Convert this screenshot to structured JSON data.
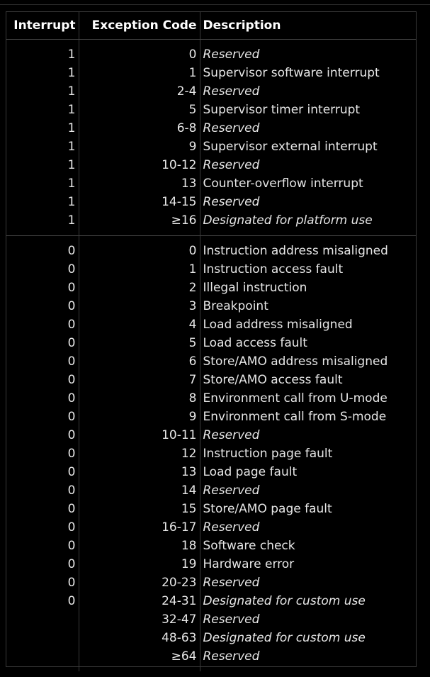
{
  "table": {
    "headers": {
      "interrupt": "Interrupt",
      "exception_code": "Exception Code",
      "description": "Description"
    },
    "interrupt_rows": [
      {
        "interrupt": "1",
        "code": "0",
        "description": "Reserved",
        "italic": true
      },
      {
        "interrupt": "1",
        "code": "1",
        "description": "Supervisor software interrupt",
        "italic": false
      },
      {
        "interrupt": "1",
        "code": "2-4",
        "description": "Reserved",
        "italic": true
      },
      {
        "interrupt": "1",
        "code": "5",
        "description": "Supervisor timer interrupt",
        "italic": false
      },
      {
        "interrupt": "1",
        "code": "6-8",
        "description": "Reserved",
        "italic": true
      },
      {
        "interrupt": "1",
        "code": "9",
        "description": "Supervisor external interrupt",
        "italic": false
      },
      {
        "interrupt": "1",
        "code": "10-12",
        "description": "Reserved",
        "italic": true
      },
      {
        "interrupt": "1",
        "code": "13",
        "description": "Counter-overflow interrupt",
        "italic": false
      },
      {
        "interrupt": "1",
        "code": "14-15",
        "description": "Reserved",
        "italic": true
      },
      {
        "interrupt": "1",
        "code": "≥16",
        "description": "Designated for platform use",
        "italic": true
      }
    ],
    "exception_rows": [
      {
        "interrupt": "0",
        "code": "0",
        "description": "Instruction address misaligned",
        "italic": false
      },
      {
        "interrupt": "0",
        "code": "1",
        "description": "Instruction access fault",
        "italic": false
      },
      {
        "interrupt": "0",
        "code": "2",
        "description": "Illegal instruction",
        "italic": false
      },
      {
        "interrupt": "0",
        "code": "3",
        "description": "Breakpoint",
        "italic": false
      },
      {
        "interrupt": "0",
        "code": "4",
        "description": "Load address misaligned",
        "italic": false
      },
      {
        "interrupt": "0",
        "code": "5",
        "description": "Load access fault",
        "italic": false
      },
      {
        "interrupt": "0",
        "code": "6",
        "description": "Store/AMO address misaligned",
        "italic": false
      },
      {
        "interrupt": "0",
        "code": "7",
        "description": "Store/AMO access fault",
        "italic": false
      },
      {
        "interrupt": "0",
        "code": "8",
        "description": "Environment call from U-mode",
        "italic": false
      },
      {
        "interrupt": "0",
        "code": "9",
        "description": "Environment call from S-mode",
        "italic": false
      },
      {
        "interrupt": "0",
        "code": "10-11",
        "description": "Reserved",
        "italic": true
      },
      {
        "interrupt": "0",
        "code": "12",
        "description": "Instruction page fault",
        "italic": false
      },
      {
        "interrupt": "0",
        "code": "13",
        "description": "Load page fault",
        "italic": false
      },
      {
        "interrupt": "0",
        "code": "14",
        "description": "Reserved",
        "italic": true
      },
      {
        "interrupt": "0",
        "code": "15",
        "description": "Store/AMO page fault",
        "italic": false
      },
      {
        "interrupt": "0",
        "code": "16-17",
        "description": "Reserved",
        "italic": true
      },
      {
        "interrupt": "0",
        "code": "18",
        "description": "Software check",
        "italic": false
      },
      {
        "interrupt": "0",
        "code": "19",
        "description": "Hardware error",
        "italic": false
      },
      {
        "interrupt": "0",
        "code": "20-23",
        "description": "Reserved",
        "italic": true
      },
      {
        "interrupt": "0",
        "code": "24-31",
        "description": "Designated for custom use",
        "italic": true
      },
      {
        "interrupt": "",
        "code": "32-47",
        "description": "Reserved",
        "italic": true
      },
      {
        "interrupt": "",
        "code": "48-63",
        "description": "Designated for custom use",
        "italic": true
      },
      {
        "interrupt": "",
        "code": "≥64",
        "description": "Reserved",
        "italic": true
      }
    ]
  }
}
